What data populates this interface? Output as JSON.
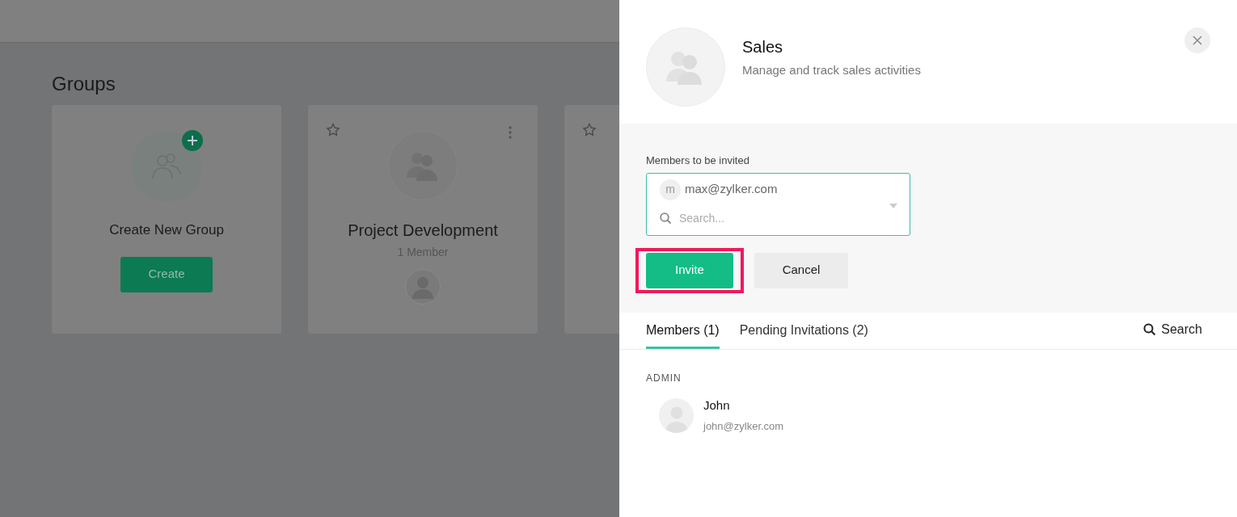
{
  "page": {
    "title": "Groups"
  },
  "groups": [
    {
      "kind": "create",
      "name": "Create New Group",
      "button": "Create"
    },
    {
      "kind": "group",
      "name": "Project Development",
      "members": "1 Member",
      "starred": false
    },
    {
      "kind": "group",
      "starred": false
    }
  ],
  "panel": {
    "title": "Sales",
    "description": "Manage and track sales activities",
    "invite": {
      "label": "Members to be invited",
      "chips": [
        {
          "initial": "m",
          "email": "max@zylker.com"
        }
      ],
      "placeholder": "Search..."
    },
    "buttons": [
      {
        "label": "Invite",
        "kind": "primary",
        "highlighted": true
      },
      {
        "label": "Cancel",
        "kind": "secondary",
        "highlighted": false
      }
    ],
    "tabs": [
      {
        "label": "Members (1)",
        "selected": true
      },
      {
        "label": "Pending Invitations (2)",
        "selected": false
      }
    ],
    "search": "Search",
    "sections": [
      {
        "heading": "ADMIN",
        "members": [
          {
            "name": "John",
            "email": "john@zylker.com"
          }
        ]
      }
    ]
  }
}
